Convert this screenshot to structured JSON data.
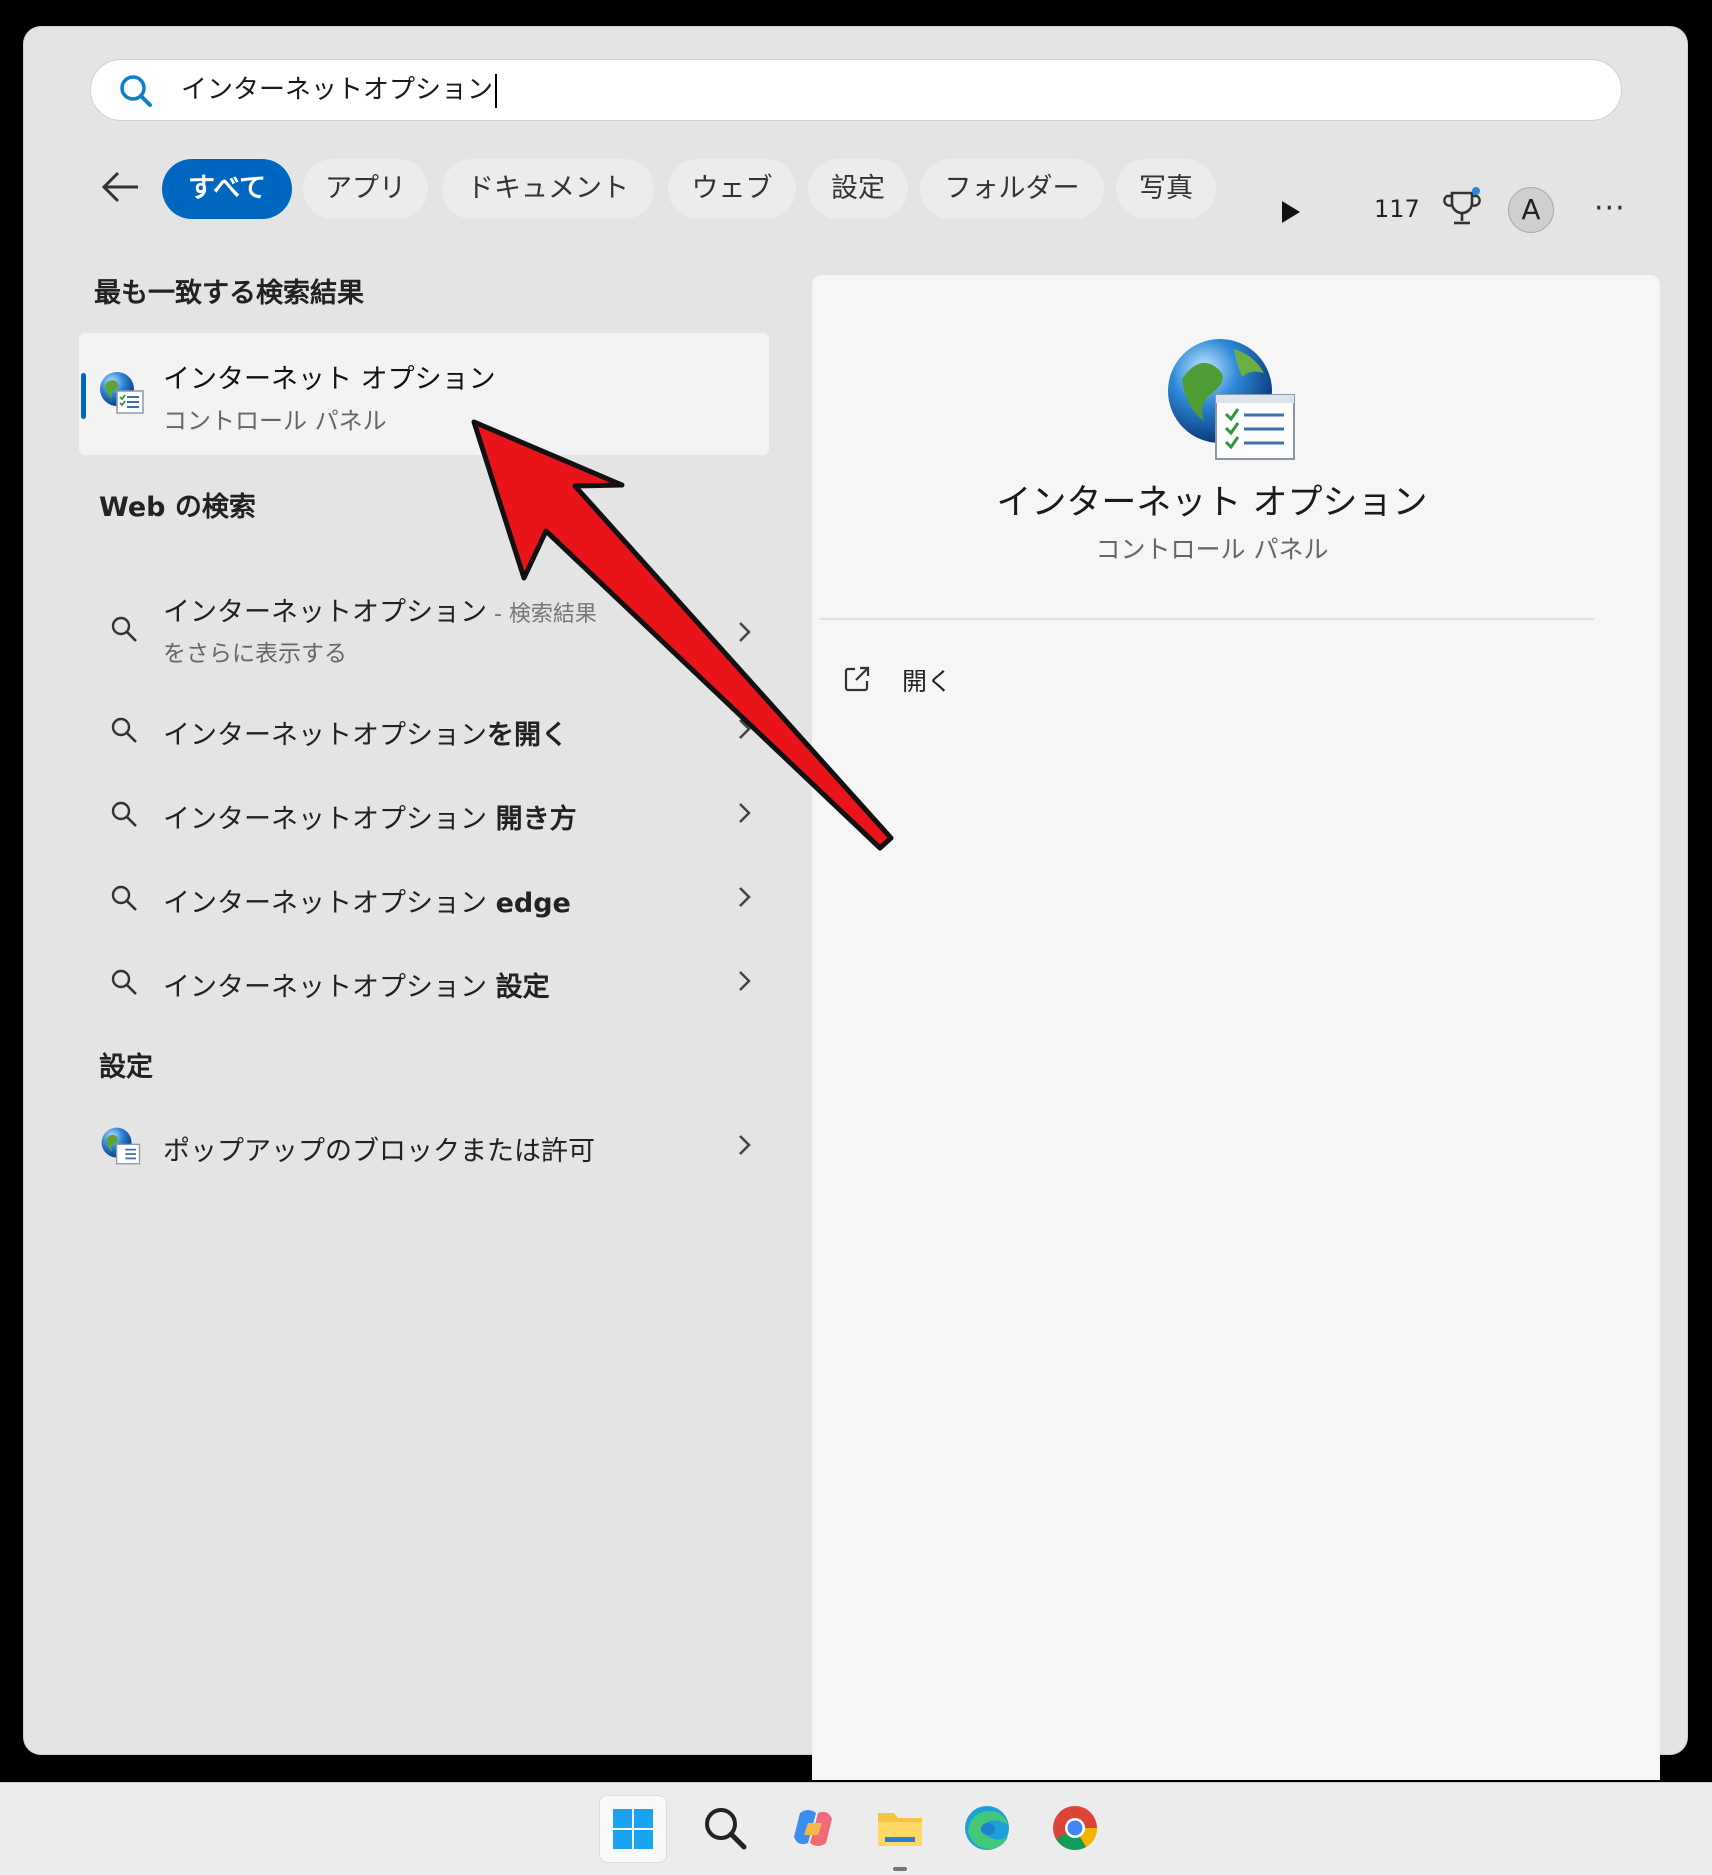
{
  "search": {
    "value": "インターネットオプション"
  },
  "filters": [
    "すべて",
    "アプリ",
    "ドキュメント",
    "ウェブ",
    "設定",
    "フォルダー",
    "写真"
  ],
  "header": {
    "points": "117",
    "avatar_letter": "A",
    "more": "···"
  },
  "best_match": {
    "heading": "最も一致する検索結果",
    "title": "インターネット オプション",
    "subtitle": "コントロール パネル"
  },
  "web": {
    "heading": "Web の検索",
    "first": {
      "main": "インターネットオプション",
      "suffix": " - 検索結果",
      "line2": "をさらに表示する"
    },
    "items": [
      {
        "base": "インターネットオプション",
        "bold": "を開く"
      },
      {
        "base": "インターネットオプション ",
        "bold": "開き方"
      },
      {
        "base": "インターネットオプション ",
        "bold": "edge"
      },
      {
        "base": "インターネットオプション ",
        "bold": "設定"
      }
    ]
  },
  "settings": {
    "heading": "設定",
    "item": "ポップアップのブロックまたは許可"
  },
  "preview": {
    "title": "インターネット オプション",
    "subtitle": "コントロール パネル",
    "open_label": "開く"
  },
  "colors": {
    "accent": "#0067c0",
    "arrow": "#e8141a",
    "panel": "#e4e4e4"
  },
  "taskbar": [
    "start-icon",
    "search-icon",
    "copilot-icon",
    "file-explorer-icon",
    "edge-icon",
    "chrome-icon"
  ]
}
